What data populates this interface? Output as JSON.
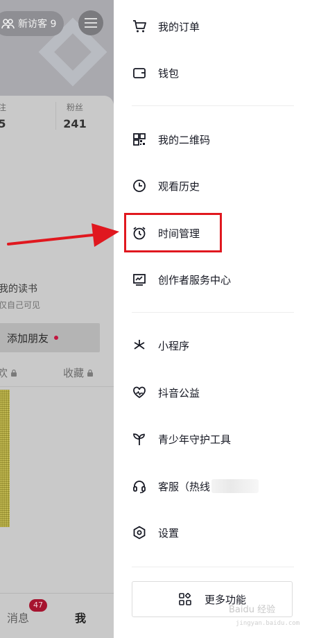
{
  "background_profile": {
    "visitor_pill": "新访客 9",
    "stats": [
      {
        "label": "注",
        "value": "5"
      },
      {
        "label": "粉丝",
        "value": "241"
      }
    ],
    "reading_title": "我的读书",
    "reading_visibility": "仅自己可见",
    "add_friend_label": "添加朋友",
    "tabs": [
      {
        "label": "欢"
      },
      {
        "label": "收藏"
      }
    ],
    "bottom_nav": {
      "messages_label": "消息",
      "messages_badge": "47",
      "me_label": "我"
    }
  },
  "drawer": {
    "items": [
      {
        "label": "我的订单",
        "icon": "cart-icon"
      },
      {
        "label": "钱包",
        "icon": "wallet-icon"
      },
      {
        "label": "我的二维码",
        "icon": "qrcode-icon"
      },
      {
        "label": "观看历史",
        "icon": "clock-icon"
      },
      {
        "label": "时间管理",
        "icon": "alarm-clock-icon"
      },
      {
        "label": "创作者服务中心",
        "icon": "monitor-chart-icon"
      },
      {
        "label": "小程序",
        "icon": "asterisk-icon"
      },
      {
        "label": "抖音公益",
        "icon": "heart-pulse-icon"
      },
      {
        "label": "青少年守护工具",
        "icon": "sprout-icon"
      },
      {
        "label": "客服（热线",
        "icon": "headset-icon"
      },
      {
        "label": "设置",
        "icon": "hexagon-gear-icon"
      }
    ],
    "more_button": "更多功能"
  },
  "annotation": {
    "highlight_color": "#e0181f",
    "arrow_color": "#e0181f"
  },
  "watermark": {
    "text": "Baidu 经验",
    "url": "jingyan.baidu.com"
  }
}
